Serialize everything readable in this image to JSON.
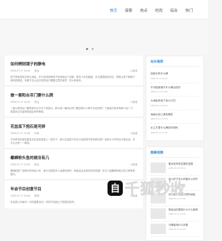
{
  "nav": {
    "items": [
      {
        "label": "首页",
        "active": true
      },
      {
        "label": "探索",
        "active": false
      },
      {
        "label": "热点",
        "active": false
      },
      {
        "label": "时尚",
        "active": false
      },
      {
        "label": "综合",
        "active": false
      },
      {
        "label": "热门",
        "active": false
      }
    ]
  },
  "banner": {
    "dot_count": 2
  },
  "articles": [
    {
      "title": "如何辨别镜子的静电",
      "date": "2025-07-17 15:43",
      "author": "综合",
      "views": "人阅读",
      "desc": "镜子是家居常见的日用品，关于如何辨别镜子的静电这个问题，很多人存在疑惑。本文整理相关知识，帮助大家了解镜子静电的原因、判断方法以及日常清洁中需要注意的事项，供大家参考。"
    },
    {
      "title": "做一套阳台吊门要什么牌",
      "date": "2025-07-17 13:25",
      "author": "热点",
      "views": "人阅读",
      "desc": "一直以来阳台门都是家中必不可少的部分，那么做一套阳台吊门要选择什么牌子比较好呢？下面我们就来简单介绍一下，希望对正在装修的朋友有所帮助。"
    },
    {
      "title": "花盆底下抱石是河卵",
      "date": "2025-07-17 12:46",
      "author": "时尚",
      "views": "人阅读",
      "desc": "许多养花的朋友都会在花盆底部垫上一层石子，那么花盆底下的石头到底是不是河卵石呢？选择什么样的石头更合适，本文为大家一一解答。"
    },
    {
      "title": "螺蛳粉头鱼的做法有几",
      "date": "2025-07-17 11:30",
      "author": "综合",
      "views": "人阅读",
      "desc": "螺蛳粉是广西柳州的特色小吃，鱼头也是很多人喜爱的食材，两者结合会是怎样的味道？本文介绍螺蛳粉鱼头的几种家常做法。"
    },
    {
      "title": "年会节目创意节目",
      "date": "2025-07-17 10:08",
      "author": "探索",
      "views": "人阅读",
      "desc": "年会是公司每年一次的重要活动，好的节目能让气氛更加热烈。"
    }
  ],
  "sidebar": {
    "links_title": "站长推荐",
    "links": [
      {
        "text": "回收手机什么牌",
        "date": "2025-07-17 15:22"
      },
      {
        "text": "不可能用锅子什么牌比较好",
        "date": "2025-07-17 14:50"
      },
      {
        "text": "大地板的地下怎么打扫",
        "date": "2025-07-17 13:44"
      },
      {
        "text": "海雨分钟工具有哪些",
        "date": "2025-07-17 12:36"
      },
      {
        "text": "水立方里什么牌的好用吗",
        "date": "2025-07-17 11:18"
      }
    ],
    "thumbs_title": "图解视频",
    "thumbs": [
      {
        "title": "集优卖有其定做的范围",
        "date": "2025-07-17 15:10"
      },
      {
        "title": "用小炉子怎么样做可以开炉了",
        "date": "2025-07-17 14:32"
      },
      {
        "title": "四小柴是哪里的机构油板",
        "date": "2025-07-17 13:56"
      },
      {
        "title": "鸭血油灰要用什么什么新闻",
        "date": "2025-07-17 13:02"
      },
      {
        "title": "马蹄卷用什么好看",
        "date": "2025-07-17 12:15"
      }
    ]
  },
  "watermark": {
    "icon": "自",
    "text": "千狐秒收"
  }
}
